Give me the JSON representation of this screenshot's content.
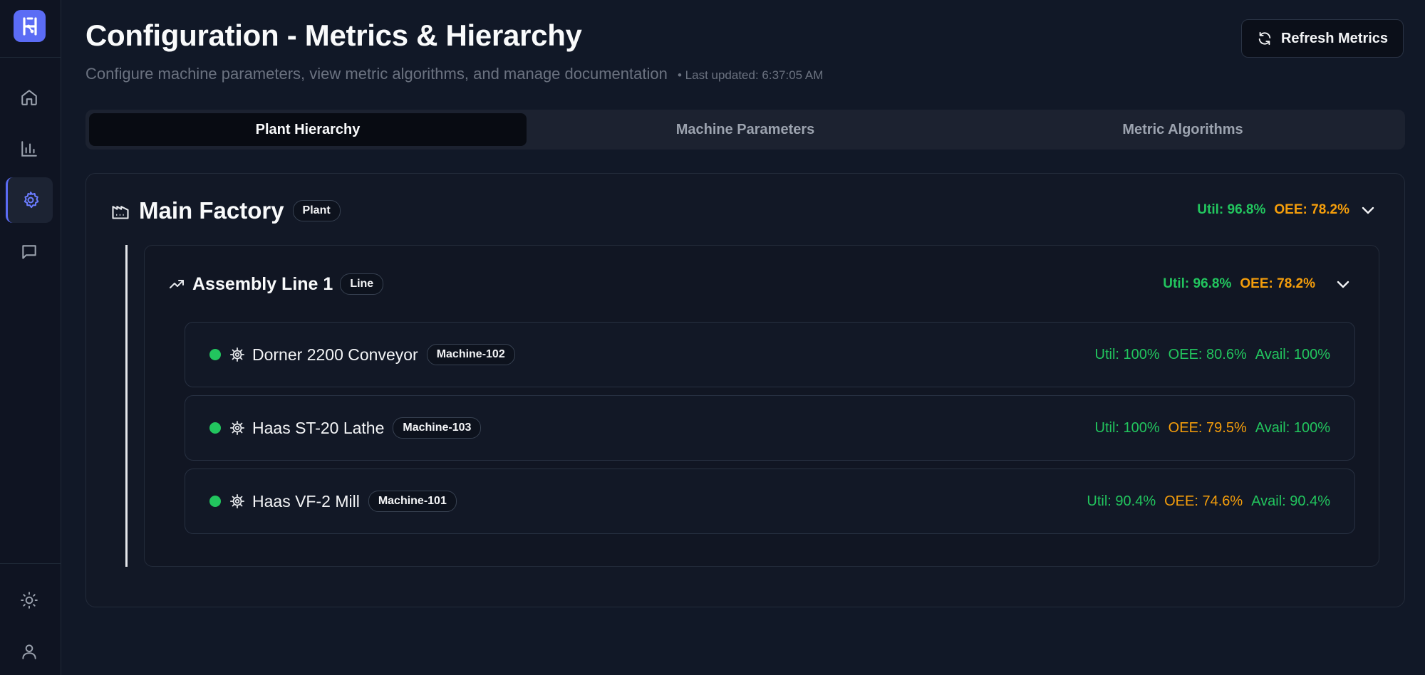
{
  "app": {
    "logo_icon": "h-logo-icon"
  },
  "sidebar": {
    "items": [
      {
        "name": "home",
        "icon": "home-icon"
      },
      {
        "name": "analytics",
        "icon": "bar-chart-icon"
      },
      {
        "name": "configuration",
        "icon": "gear-icon",
        "active": true
      },
      {
        "name": "chat",
        "icon": "message-icon"
      }
    ],
    "bottom": [
      {
        "name": "theme",
        "icon": "sun-icon"
      },
      {
        "name": "profile",
        "icon": "user-icon"
      }
    ]
  },
  "header": {
    "title": "Configuration - Metrics & Hierarchy",
    "subtitle": "Configure machine parameters, view metric algorithms, and manage documentation",
    "last_updated": "• Last updated: 6:37:05 AM",
    "refresh_label": "Refresh Metrics"
  },
  "tabs": [
    {
      "label": "Plant Hierarchy",
      "active": true
    },
    {
      "label": "Machine Parameters",
      "active": false
    },
    {
      "label": "Metric Algorithms",
      "active": false
    }
  ],
  "plant": {
    "name": "Main Factory",
    "badge": "Plant",
    "util": "Util: 96.8%",
    "oee": "OEE: 78.2%",
    "line": {
      "name": "Assembly Line 1",
      "badge": "Line",
      "util": "Util: 96.8%",
      "oee": "OEE: 78.2%",
      "machines": [
        {
          "name": "Dorner 2200 Conveyor",
          "badge": "Machine-102",
          "util": "Util: 100%",
          "oee": "OEE: 80.6%",
          "avail": "Avail: 100%",
          "oee_color": "#22c55e",
          "status_color": "#22c55e"
        },
        {
          "name": "Haas ST-20 Lathe",
          "badge": "Machine-103",
          "util": "Util: 100%",
          "oee": "OEE: 79.5%",
          "avail": "Avail: 100%",
          "oee_color": "#f59e0b",
          "status_color": "#22c55e"
        },
        {
          "name": "Haas VF-2 Mill",
          "badge": "Machine-101",
          "util": "Util: 90.4%",
          "oee": "OEE: 74.6%",
          "avail": "Avail: 90.4%",
          "oee_color": "#f59e0b",
          "status_color": "#22c55e"
        }
      ]
    }
  },
  "colors": {
    "accent": "#5b6cf5",
    "good": "#22c55e",
    "warn": "#f59e0b",
    "background": "#111827"
  }
}
